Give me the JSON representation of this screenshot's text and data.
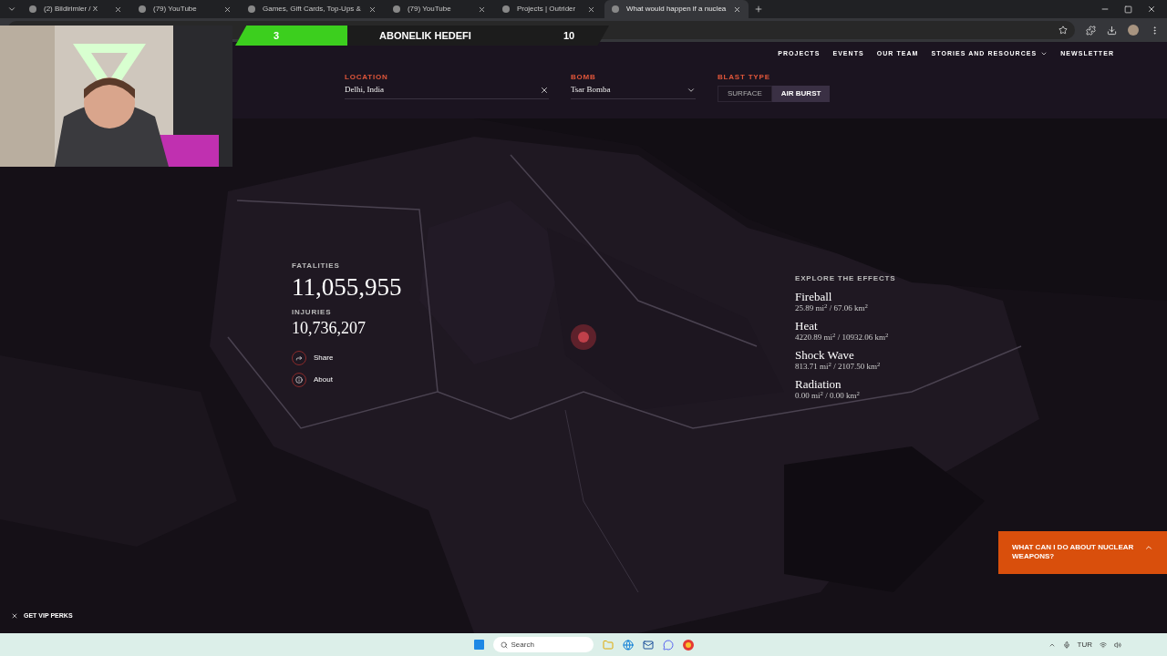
{
  "browser": {
    "tabs": [
      {
        "title": "(2) Bildirimler / X",
        "selected": false
      },
      {
        "title": "(79) YouTube",
        "selected": false
      },
      {
        "title": "Games, Gift Cards, Top-Ups &",
        "selected": false
      },
      {
        "title": "(79) YouTube",
        "selected": false
      },
      {
        "title": "Projects | Outrider",
        "selected": false
      },
      {
        "title": "What would happen if a nuclea",
        "selected": true
      }
    ]
  },
  "stream_overlay": {
    "current": "3",
    "label": "ABONELIK HEDEFI",
    "goal": "10",
    "level": 0.3
  },
  "nav": [
    {
      "label": "PROJECTS",
      "kind": "link"
    },
    {
      "label": "EVENTS",
      "kind": "link"
    },
    {
      "label": "OUR TEAM",
      "kind": "link"
    },
    {
      "label": "STORIES AND RESOURCES",
      "kind": "dropdown"
    },
    {
      "label": "NEWSLETTER",
      "kind": "link"
    }
  ],
  "controls": {
    "location": {
      "label": "LOCATION",
      "value": "Delhi, India"
    },
    "bomb": {
      "label": "BOMB",
      "value": "Tsar Bomba"
    },
    "blast_type": {
      "label": "BLAST TYPE",
      "options": [
        {
          "label": "SURFACE",
          "selected": false
        },
        {
          "label": "AIR BURST",
          "selected": true
        }
      ]
    }
  },
  "stats": {
    "fatalities": {
      "label": "FATALITIES",
      "value": "11,055,955"
    },
    "injuries": {
      "label": "INJURIES",
      "value": "10,736,207"
    }
  },
  "actions": [
    {
      "label": "Share",
      "kind": "share"
    },
    {
      "label": "About",
      "kind": "about"
    }
  ],
  "effects": {
    "title": "EXPLORE THE EFFECTS",
    "items": [
      {
        "name": "Fireball",
        "area": "25.89 mi$^{2}$ / 67.06 km$^{2}$"
      },
      {
        "name": "Heat",
        "area": "4220.89 mi$^{2}$ / 10932.06 km$^{2}$"
      },
      {
        "name": "Shock Wave",
        "area": "813.71 mi$^{2}$ / 2107.50 km$^{2}$"
      },
      {
        "name": "Radiation",
        "area": "0.00 mi$^{2}$ / 0.00 km$^{2}$"
      }
    ]
  },
  "help_panel": {
    "text": "WHAT CAN I DO ABOUT NUCLEAR WEAPONS?",
    "expanded": false
  },
  "vip": {
    "label": "GET VIP PERKS"
  },
  "taskbar": {
    "search_placeholder": "Search",
    "language": "TUR"
  }
}
